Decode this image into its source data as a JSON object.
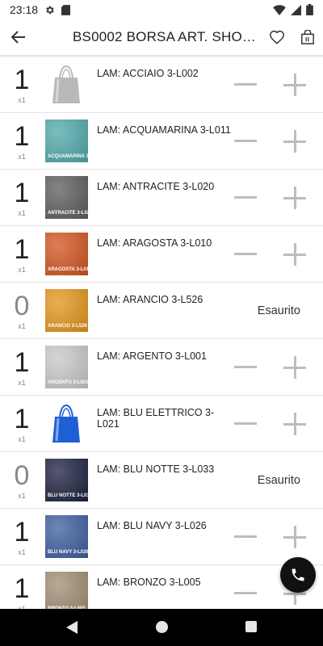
{
  "status": {
    "time": "23:18"
  },
  "app_bar": {
    "title": "BS0002 BORSA ART. SHOPP..."
  },
  "items": [
    {
      "qty": "1",
      "mult": "x1",
      "name": "LAM: ACCIAIO 3-L002",
      "thumb_label": "",
      "thumb_type": "bag",
      "color": "#b9b9bb",
      "available": true
    },
    {
      "qty": "1",
      "mult": "x1",
      "name": "LAM: ACQUAMARINA 3-L011",
      "thumb_label": "ACQUAMARINA 3-L011",
      "thumb_type": "swatch",
      "color": "#4fa9ab",
      "available": true
    },
    {
      "qty": "1",
      "mult": "x1",
      "name": "LAM: ANTRACITE 3-L020",
      "thumb_label": "ANTRACITE 3-L020",
      "thumb_type": "swatch",
      "color": "#5d5c5a",
      "available": true
    },
    {
      "qty": "1",
      "mult": "x1",
      "name": "LAM: ARAGOSTA 3-L010",
      "thumb_label": "ARAGOSTA 3-L010",
      "thumb_type": "swatch",
      "color": "#d2531f",
      "available": true
    },
    {
      "qty": "0",
      "mult": "x1",
      "name": "LAM: ARANCIO 3-L526",
      "thumb_label": "ARANCIO 3-L526",
      "thumb_type": "swatch",
      "color": "#e3941a",
      "available": false,
      "status": "Esaurito"
    },
    {
      "qty": "1",
      "mult": "x1",
      "name": "LAM: ARGENTO 3-L001",
      "thumb_label": "ARGENTO 3-L001",
      "thumb_type": "swatch",
      "color": "#c7c8cb",
      "available": true
    },
    {
      "qty": "1",
      "mult": "x1",
      "name": "LAM: BLU ELETTRICO 3-L021",
      "thumb_label": "",
      "thumb_type": "bag",
      "color": "#1f5fd6",
      "available": true
    },
    {
      "qty": "0",
      "mult": "x1",
      "name": "LAM: BLU NOTTE 3-L033",
      "thumb_label": "BLU NOTTE 3-L033",
      "thumb_type": "swatch",
      "color": "#1b1f3e",
      "available": false,
      "status": "Esaurito"
    },
    {
      "qty": "1",
      "mult": "x1",
      "name": "LAM: BLU NAVY 3-L026",
      "thumb_label": "BLU NAVY 3-L026",
      "thumb_type": "swatch",
      "color": "#3c5d9e",
      "available": true
    },
    {
      "qty": "1",
      "mult": "x1",
      "name": "LAM: BRONZO 3-L005",
      "thumb_label": "BRONZO 3-L005",
      "thumb_type": "swatch",
      "color": "#a08d72",
      "available": true
    }
  ],
  "icons": {
    "back": "arrow-back-icon",
    "favorite": "heart-outline-icon",
    "cart": "shopping-bag-icon",
    "fab": "phone-icon"
  }
}
